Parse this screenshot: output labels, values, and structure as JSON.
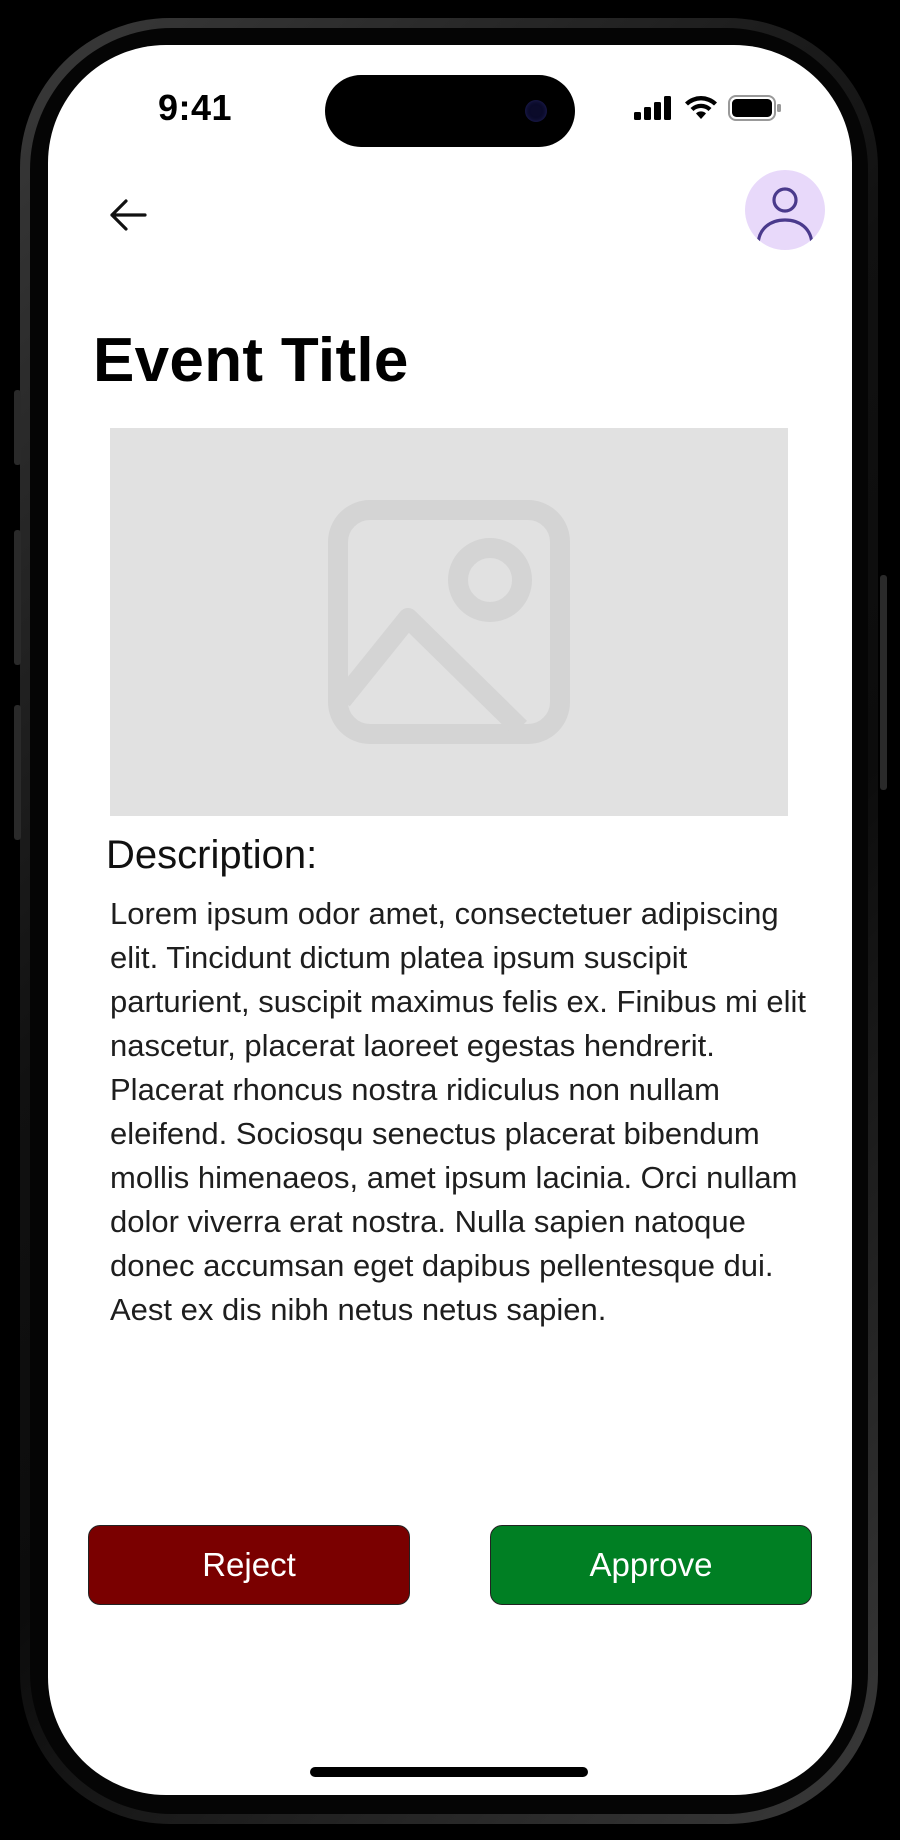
{
  "status_bar": {
    "time": "9:41"
  },
  "header": {
    "back_icon": "arrow-left-icon",
    "avatar_icon": "user-icon",
    "avatar_bg": "#e8d9fa",
    "avatar_fg": "#4a3a8c"
  },
  "event": {
    "title": "Event Title",
    "image_icon": "image-placeholder-icon",
    "description_label": "Description:",
    "description": "Lorem ipsum odor amet, consectetuer adipiscing elit. Tincidunt dictum platea ipsum suscipit parturient, suscipit maximus felis ex. Finibus mi elit nascetur, placerat laoreet egestas hendrerit. Placerat rhoncus nostra ridiculus non nullam eleifend. Sociosqu senectus placerat bibendum mollis himenaeos, amet ipsum lacinia. Orci nullam dolor viverra erat nostra. Nulla sapien natoque donec accumsan eget dapibus pellentesque dui. Aest ex dis nibh netus netus sapien."
  },
  "actions": {
    "reject_label": "Reject",
    "approve_label": "Approve",
    "reject_color": "#7a0000",
    "approve_color": "#007f23"
  }
}
